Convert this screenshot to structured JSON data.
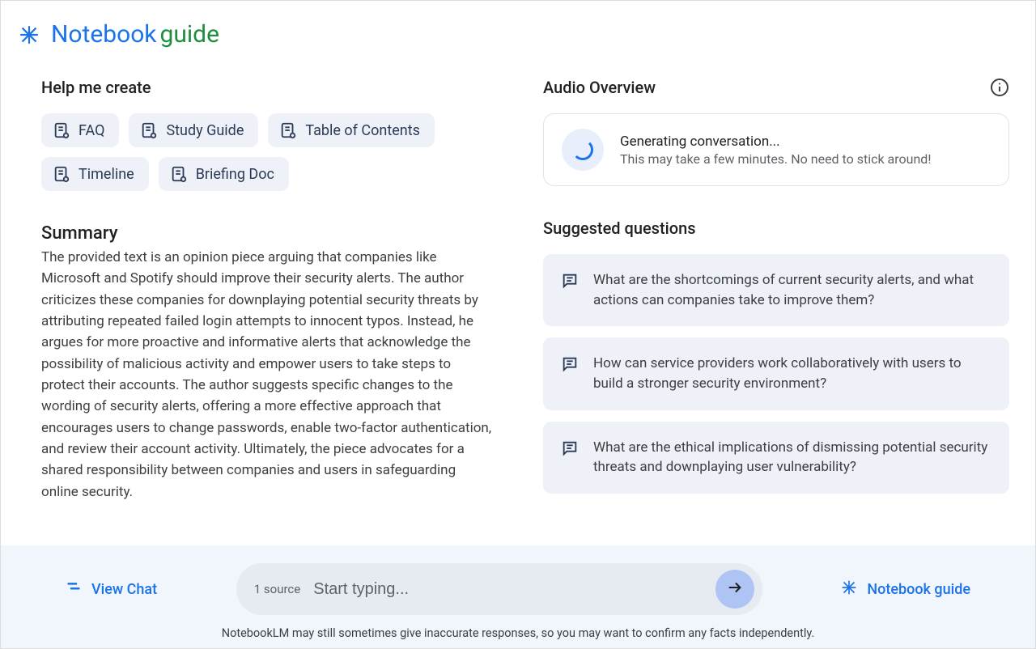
{
  "header": {
    "title_notebook": "Notebook",
    "title_guide": "guide"
  },
  "left": {
    "help_me_create_title": "Help me create",
    "chips": [
      {
        "label": "FAQ"
      },
      {
        "label": "Study Guide"
      },
      {
        "label": "Table of Contents"
      },
      {
        "label": "Timeline"
      },
      {
        "label": "Briefing Doc"
      }
    ],
    "summary_title": "Summary",
    "summary_text": "The provided text is an opinion piece arguing that companies like Microsoft and Spotify should improve their security alerts. The author criticizes these companies for downplaying potential security threats by attributing repeated failed login attempts to innocent typos. Instead, he argues for more proactive and informative alerts that acknowledge the possibility of malicious activity and empower users to take steps to protect their accounts. The author suggests specific changes to the wording of security alerts, offering a more effective approach that encourages users to change passwords, enable two-factor authentication, and review their account activity. Ultimately, the piece advocates for a shared responsibility between companies and users in safeguarding online security."
  },
  "right": {
    "audio_overview_title": "Audio Overview",
    "audio_generating_title": "Generating conversation...",
    "audio_generating_subtitle": "This may take a few minutes. No need to stick around!",
    "suggested_questions_title": "Suggested questions",
    "questions": [
      "What are the shortcomings of current security alerts, and what actions can companies take to improve them?",
      "How can service providers work collaboratively with users to build a stronger security environment?",
      "What are the ethical implications of dismissing potential security threats and downplaying user vulnerability?"
    ]
  },
  "bottom": {
    "view_chat_label": "View Chat",
    "source_count": "1 source",
    "input_placeholder": "Start typing...",
    "notebook_guide_label": "Notebook guide",
    "disclaimer": "NotebookLM may still sometimes give inaccurate responses, so you may want to confirm any facts independently."
  }
}
